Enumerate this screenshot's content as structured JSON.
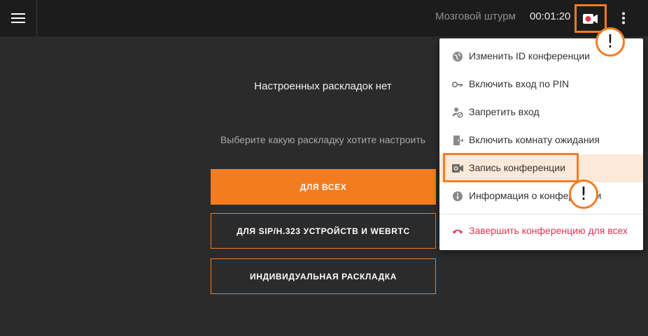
{
  "header": {
    "menu_icon": "hamburger-icon",
    "conference_name": "Мозговой штурм",
    "timer": "00:01:20",
    "record_icon": "video-record-icon",
    "more_icon": "more-vertical-icon"
  },
  "main": {
    "empty_title": "Настроенных раскладок нет",
    "empty_subtitle": "Выберите какую раскладку хотите настроить",
    "btn_all": "ДЛЯ ВСЕХ",
    "btn_sip": "ДЛЯ SIP/H.323 УСТРОЙСТВ И WEBRTC",
    "btn_custom": "ИНДИВИДУАЛЬНАЯ РАСКЛАДКА"
  },
  "dropdown": {
    "items": [
      {
        "label": "Изменить ID конференции",
        "icon": "globe-icon"
      },
      {
        "label": "Включить вход по PIN",
        "icon": "key-icon"
      },
      {
        "label": "Запретить вход",
        "icon": "user-block-icon"
      },
      {
        "label": "Включить комнату ожидания",
        "icon": "door-icon"
      },
      {
        "label": "Запись конференции",
        "icon": "video-camera-icon"
      },
      {
        "label": "Информация о конференции",
        "icon": "info-icon"
      }
    ],
    "end_label": "Завершить конференцию для всех",
    "end_icon": "phone-hangup-icon"
  },
  "annotations": {
    "badge_1": "!",
    "badge_2": "!"
  },
  "colors": {
    "accent": "#f47c20",
    "danger": "#e0334f",
    "record_dot": "#e0334f",
    "background": "#2b2b2b",
    "topbar": "#1c1c1c"
  }
}
